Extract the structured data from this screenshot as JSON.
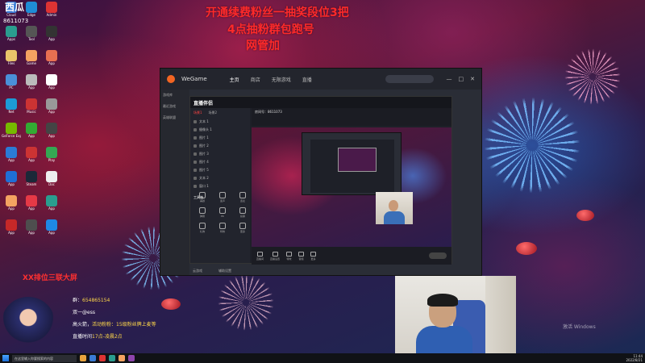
{
  "overlay": {
    "logo": "西瓜",
    "room_number": "8611073",
    "line1": "开通续费粉丝一抽奖段位3把",
    "line2": "4点抽粉群包跑号",
    "line3": "网管加"
  },
  "desktop_icons": [
    {
      "label": "Cloud",
      "icon": "app-icon",
      "color": "#3a7bd5"
    },
    {
      "label": "Edge",
      "icon": "app-icon",
      "color": "#1f8dd6"
    },
    {
      "label": "Admin",
      "icon": "app-icon",
      "color": "#d33"
    },
    {
      "label": "Apps",
      "icon": "app-icon",
      "color": "#2a9d8f"
    },
    {
      "label": "Tool",
      "icon": "app-icon",
      "color": "#555"
    },
    {
      "label": "App",
      "icon": "app-icon",
      "color": "#333"
    },
    {
      "label": "Files",
      "icon": "app-icon",
      "color": "#e9c46a"
    },
    {
      "label": "Game",
      "icon": "app-icon",
      "color": "#f4a261"
    },
    {
      "label": "App",
      "icon": "app-icon",
      "color": "#e76f51"
    },
    {
      "label": "PC",
      "icon": "app-icon",
      "color": "#4a90d9"
    },
    {
      "label": "App",
      "icon": "app-icon",
      "color": "#bbb"
    },
    {
      "label": "App",
      "icon": "app-icon",
      "color": "#fff"
    },
    {
      "label": "Net",
      "icon": "app-icon",
      "color": "#1c9bd6"
    },
    {
      "label": "Music",
      "icon": "app-icon",
      "color": "#c33"
    },
    {
      "label": "App",
      "icon": "app-icon",
      "color": "#999"
    },
    {
      "label": "GeForce Experience",
      "icon": "app-icon",
      "color": "#76b900"
    },
    {
      "label": "App",
      "icon": "app-icon",
      "color": "#3a3"
    },
    {
      "label": "App",
      "icon": "app-icon",
      "color": "#444"
    },
    {
      "label": "App",
      "icon": "app-icon",
      "color": "#2b7bd5"
    },
    {
      "label": "App",
      "icon": "app-icon",
      "color": "#c33"
    },
    {
      "label": "Play",
      "icon": "app-icon",
      "color": "#34a853"
    },
    {
      "label": "App",
      "icon": "app-icon",
      "color": "#1f6fd6"
    },
    {
      "label": "Steam",
      "icon": "app-icon",
      "color": "#1b2838"
    },
    {
      "label": "Doc",
      "icon": "app-icon",
      "color": "#eee"
    },
    {
      "label": "App",
      "icon": "app-icon",
      "color": "#f4a261"
    },
    {
      "label": "App",
      "icon": "app-icon",
      "color": "#e63946"
    },
    {
      "label": "App",
      "icon": "app-icon",
      "color": "#2a9d8f"
    },
    {
      "label": "App",
      "icon": "app-icon",
      "color": "#c62828"
    },
    {
      "label": "App",
      "icon": "app-icon",
      "color": "#4e4e4e"
    },
    {
      "label": "App",
      "icon": "app-icon",
      "color": "#1e88e5"
    }
  ],
  "wegame": {
    "title": "WeGame",
    "nav": [
      "主页",
      "商店",
      "无限游戏",
      "直播"
    ],
    "controls": [
      "—",
      "□",
      "✕"
    ],
    "sidebar": [
      "游戏库",
      "最近游戏",
      "英雄联盟"
    ],
    "bottom": [
      "云游戏",
      "辅助设置"
    ]
  },
  "liveapp": {
    "brand": "直播伴侣",
    "tabs": [
      "场景1",
      "场景2"
    ],
    "scenes": [
      "文本 1",
      "摄像头 1",
      "图片 1",
      "图片 2",
      "图片 3",
      "图片 4",
      "图片 5",
      "文本 2",
      "窗口 1"
    ],
    "tools_title": "工具箱",
    "tools": [
      "美颜",
      "变声",
      "连麦",
      "弹幕",
      "PK",
      "投票",
      "礼物",
      "特效",
      "更多"
    ],
    "room": "房间号：8611073",
    "bottom_buttons": [
      "直播间",
      "直播设置",
      "特效",
      "音频",
      "更多"
    ],
    "start_label": "开始直播"
  },
  "chat": [
    {
      "user": "群：",
      "text": "654865154"
    },
    {
      "user": "",
      "text": "双一@ess"
    },
    {
      "user": "高火箭，",
      "text": "活动粉粉：15级粉丝牌上麦等"
    },
    {
      "user": "直播时间",
      "text": "17点-凌晨2点"
    }
  ],
  "anime_banner": "XX排位三联大屏",
  "activation": "激活 Windows",
  "taskbar": {
    "search": "在这里输入你要搜索的内容",
    "time": "11:44",
    "date": "2022/8/21"
  }
}
